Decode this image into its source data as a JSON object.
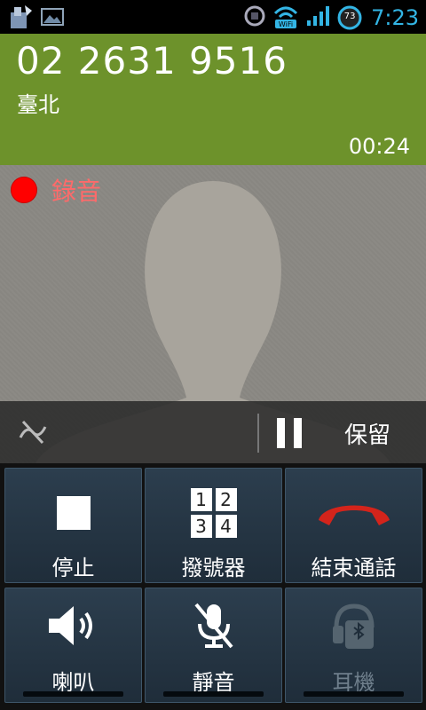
{
  "status_bar": {
    "time": "7:23",
    "battery_level": "73",
    "wifi_label": "WiFi",
    "icons_left": [
      "notification-app-icon",
      "picture-icon"
    ],
    "icons_right": [
      "sync-icon",
      "wifi-icon",
      "signal-icon",
      "battery-icon"
    ]
  },
  "call": {
    "number": "02 2631 9516",
    "location": "臺北",
    "duration": "00:24",
    "accent_color": "#6d922b"
  },
  "recording": {
    "label": "錄音",
    "dot_color": "#ff0000"
  },
  "photo_bar": {
    "hold_label": "保留",
    "icons": [
      "no-forward-icon",
      "pause-icon"
    ]
  },
  "controls": {
    "stop_label": "停止",
    "dialpad_label": "撥號器",
    "dialpad_keys": [
      "1",
      "2",
      "3",
      "4"
    ],
    "end_call_label": "結束通話",
    "speaker_label": "喇叭",
    "mute_label": "靜音",
    "headset_label": "耳機"
  }
}
